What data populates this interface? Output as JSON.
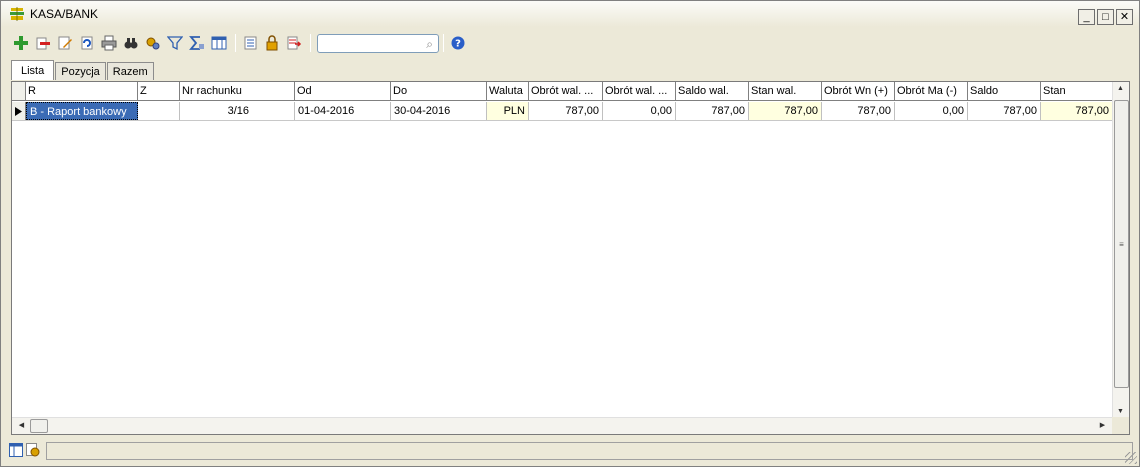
{
  "window": {
    "title": "KASA/BANK",
    "minimize_icon": "minimize-icon",
    "maximize_icon": "maximize-icon",
    "close_icon": "close-icon"
  },
  "toolbar": {
    "icons": [
      "add-icon",
      "delete-icon",
      "edit-icon",
      "refresh-icon",
      "print-icon",
      "find-icon",
      "settings-icon",
      "filter-icon",
      "sum-icon",
      "columns-icon",
      "list-icon",
      "lock-icon",
      "export-icon"
    ],
    "search_value": "",
    "help_icon": "help-icon"
  },
  "tabs": [
    {
      "label": "Lista",
      "active": true
    },
    {
      "label": "Pozycja",
      "active": false
    },
    {
      "label": "Razem",
      "active": false
    }
  ],
  "table": {
    "columns": [
      "R",
      "Z",
      "Nr rachunku",
      "Od",
      "Do",
      "Waluta",
      "Obrót wal. ...",
      "Obrót wal. ...",
      "Saldo wal.",
      "Stan wal.",
      "Obrót Wn (+)",
      "Obrót Ma (-)",
      "Saldo",
      "Stan"
    ],
    "rows": [
      {
        "r": "B - Raport bankowy",
        "z": "",
        "nr_rachunku": "3/16",
        "od": "01-04-2016",
        "do": "30-04-2016",
        "waluta": "PLN",
        "obrot_wal_1": "787,00",
        "obrot_wal_2": "0,00",
        "saldo_wal": "787,00",
        "stan_wal": "787,00",
        "obrot_wn": "787,00",
        "obrot_ma": "0,00",
        "saldo": "787,00",
        "stan": "787,00"
      }
    ]
  },
  "colors": {
    "selection": "#3b6bb5",
    "highlight_cell": "#ffffe0"
  }
}
